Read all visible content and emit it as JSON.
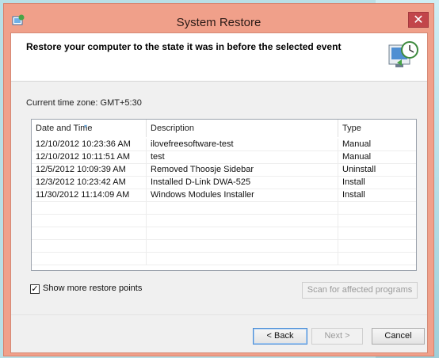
{
  "window": {
    "title": "System Restore",
    "close_glyph": "✕",
    "icon": "system-restore-icon"
  },
  "header": {
    "text": "Restore your computer to the state it was in before the selected event",
    "icon": "system-restore-clock-icon"
  },
  "timezone": "Current time zone: GMT+5:30",
  "table": {
    "columns": [
      "Date and Time",
      "Description",
      "Type"
    ],
    "rows": [
      [
        "12/10/2012 10:23:36 AM",
        "ilovefreesoftware-test",
        "Manual"
      ],
      [
        "12/10/2012 10:11:51 AM",
        "test",
        "Manual"
      ],
      [
        "12/5/2012 10:09:39 AM",
        "Removed Thoosje Sidebar",
        "Uninstall"
      ],
      [
        "12/3/2012 10:23:42 AM",
        "Installed D-Link DWA-525",
        "Install"
      ],
      [
        "11/30/2012 11:14:09 AM",
        "Windows Modules Installer",
        "Install"
      ]
    ]
  },
  "options": {
    "show_more_label": "Show more restore points",
    "show_more_checked": true,
    "scan_label": "Scan for affected programs"
  },
  "buttons": {
    "back": "< Back",
    "next": "Next >",
    "cancel": "Cancel"
  },
  "colors": {
    "titlebar": "#f0a08a",
    "close": "#c2454a",
    "accent": "#4a8cd6"
  }
}
